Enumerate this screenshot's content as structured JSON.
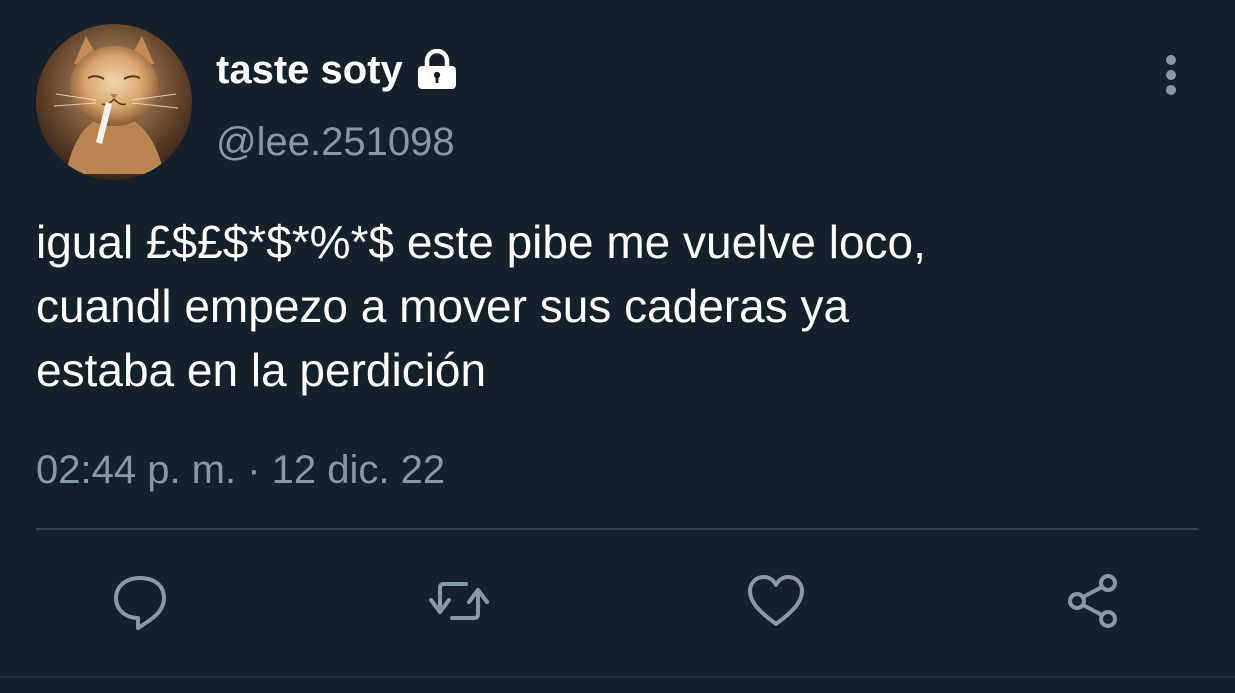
{
  "tweet": {
    "display_name": "taste soty",
    "handle": "@lee.251098",
    "text": "igual £$£$*$*%*$ este pibe me vuelve loco,\ncuandl empezo a mover sus caderas ya\nestaba en la perdición",
    "timestamp": "02:44 p. m. · 12 dic. 22",
    "protected": true
  },
  "icons": {
    "avatar": "cat-photo",
    "lock": "lock-icon",
    "more": "more-vertical-icon",
    "reply": "reply-icon",
    "retweet": "retweet-icon",
    "like": "heart-icon",
    "share": "share-icon"
  },
  "colors": {
    "background": "#15202b",
    "primary_text": "#ffffff",
    "secondary_text": "#8899a6",
    "divider": "#38444d"
  }
}
